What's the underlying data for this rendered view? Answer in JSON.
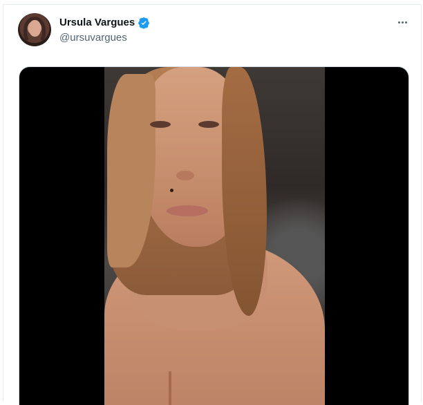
{
  "author": {
    "display_name": "Ursula Vargues",
    "handle": "@ursuvargues",
    "verified": true,
    "verified_icon": "verified-badge-icon"
  },
  "actions": {
    "more_icon": "more-options-icon"
  },
  "colors": {
    "name": "#0f1419",
    "handle": "#536471",
    "verified": "#1d9bf0",
    "border": "#e6ecf0",
    "media_background": "#000000"
  }
}
